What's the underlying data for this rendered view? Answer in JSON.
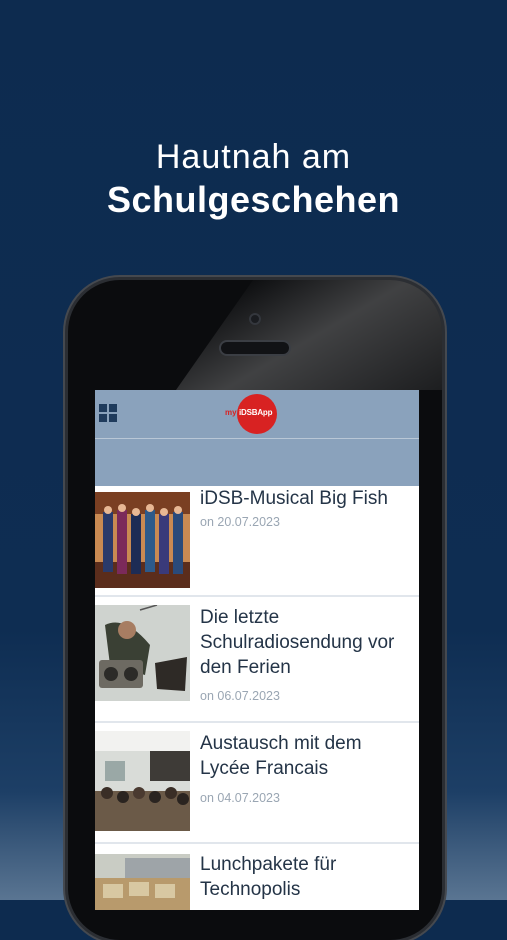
{
  "headline": {
    "line1": "Hautnah am",
    "line2": "Schulgeschehen"
  },
  "app": {
    "menu_icon": "grid-icon",
    "logo": {
      "prefix": "my",
      "brand": "iDSBApp",
      "color": "#d82222"
    },
    "header_color": "#8aa2bc"
  },
  "news": [
    {
      "title": "iDSB-Musical Big Fish",
      "date": "on 20.07.2023"
    },
    {
      "title": "Die letzte Schulradiosendung vor den Ferien",
      "date": "on 06.07.2023"
    },
    {
      "title": "Austausch mit dem Lycée Francais",
      "date": "on 04.07.2023"
    },
    {
      "title": "Lunchpakete für Technopolis",
      "date": ""
    }
  ]
}
